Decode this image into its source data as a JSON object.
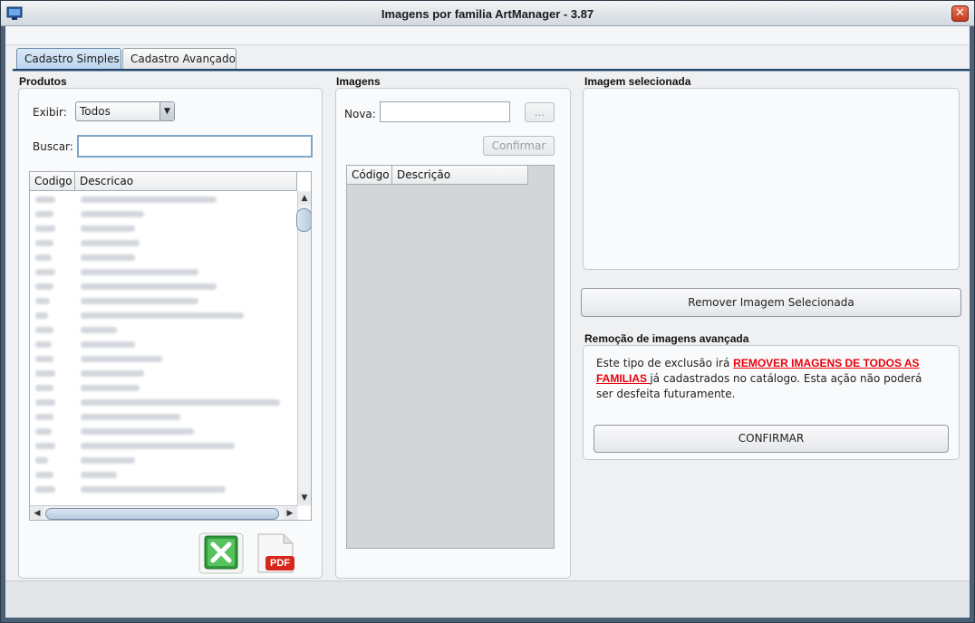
{
  "window": {
    "title": "Imagens por familia ArtManager - 3.87"
  },
  "tabs": [
    {
      "label": "Cadastro Simples",
      "active": true
    },
    {
      "label": "Cadastro Avançado",
      "active": false
    }
  ],
  "produtos": {
    "title": "Produtos",
    "exibir_label": "Exibir:",
    "exibir_value": "Todos",
    "buscar_label": "Buscar:",
    "buscar_value": "",
    "columns": [
      "Codigo",
      "Descricao"
    ],
    "excel_icon": "excel-icon",
    "pdf_icon": "pdf-icon",
    "pdf_label": "PDF"
  },
  "imagens": {
    "title": "Imagens",
    "nova_label": "Nova:",
    "nova_value": "",
    "browse_label": "...",
    "confirmar_label": "Confirmar",
    "columns": [
      "Código",
      "Descrição"
    ]
  },
  "imagem_selecionada": {
    "title": "Imagem selecionada",
    "remover_label": "Remover Imagem Selecionada"
  },
  "remocao": {
    "title": "Remoção de imagens avançada",
    "text_before": "Este tipo de exclusão irá ",
    "text_highlight": "REMOVER IMAGENS DE TODOS AS FAMILIAS ",
    "text_after": "já cadastrados no catálogo. Esta ação não poderá ser desfeita futuramente.",
    "confirmar_label": "CONFIRMAR"
  },
  "colors": {
    "tab_active": "#bcd6ee",
    "tab_underline": "#23466b",
    "warning_red": "#e8000b",
    "close_button": "#c63a1d"
  }
}
